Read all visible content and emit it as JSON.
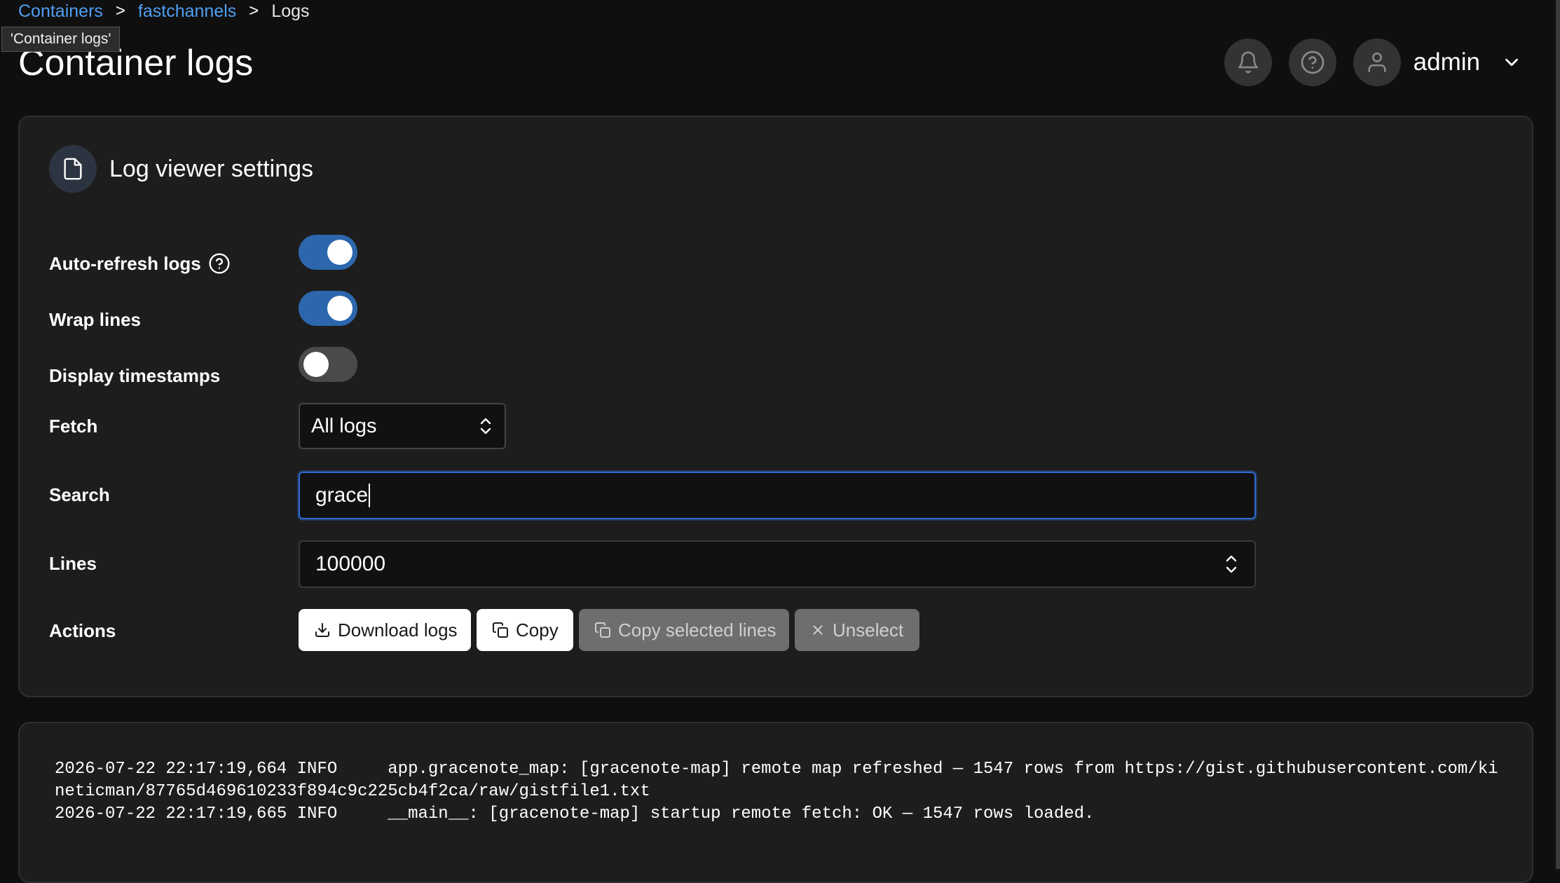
{
  "breadcrumb": {
    "items": [
      "Containers",
      "fastchannels",
      "Logs"
    ],
    "separator": ">"
  },
  "tooltip": "'Container logs'",
  "page_title": "Container logs",
  "header": {
    "username": "admin",
    "icons": [
      "bell-icon",
      "help-circle-icon",
      "user-icon",
      "chevron-down-icon"
    ]
  },
  "settings": {
    "title": "Log viewer settings",
    "auto_refresh": {
      "label": "Auto-refresh logs",
      "on": true
    },
    "wrap_lines": {
      "label": "Wrap lines",
      "on": true
    },
    "display_timestamps": {
      "label": "Display timestamps",
      "on": false
    },
    "fetch": {
      "label": "Fetch",
      "value": "All logs"
    },
    "search": {
      "label": "Search",
      "value": "grace"
    },
    "lines": {
      "label": "Lines",
      "value": "100000"
    },
    "actions": {
      "label": "Actions",
      "download": "Download logs",
      "copy": "Copy",
      "copy_selected": "Copy selected lines",
      "unselect": "Unselect"
    }
  },
  "logs": [
    "2026-07-22 22:17:19,664 INFO     app.gracenote_map: [gracenote-map] remote map refreshed — 1547 rows from https://gist.githubusercontent.com/kineticman/87765d469610233f894c9c225cb4f2ca/raw/gistfile1.txt",
    "2026-07-22 22:17:19,665 INFO     __main__: [gracenote-map] startup remote fetch: OK — 1547 rows loaded."
  ],
  "colors": {
    "accent": "#2c67ad",
    "link": "#4e9ff2",
    "background": "#0f0f0f",
    "panel": "#1d1d1d"
  }
}
